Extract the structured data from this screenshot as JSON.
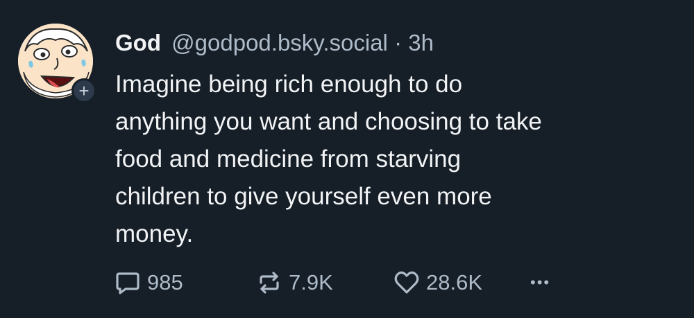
{
  "post": {
    "author": {
      "display_name": "God",
      "handle": "@godpod.bsky.social",
      "separator": "·",
      "time": "3h",
      "follow_symbol": "+"
    },
    "text_lines": [
      "Imagine being rich enough to do",
      "anything you want and choosing to take",
      "food and medicine from starving",
      "children to give yourself even more",
      "money."
    ],
    "actions": {
      "replies": "985",
      "reposts": "7.9K",
      "likes": "28.6K",
      "more_symbol": "•••"
    },
    "colors": {
      "background": "#161e27",
      "text": "#f1f3f5",
      "muted": "#aebbc9"
    }
  }
}
